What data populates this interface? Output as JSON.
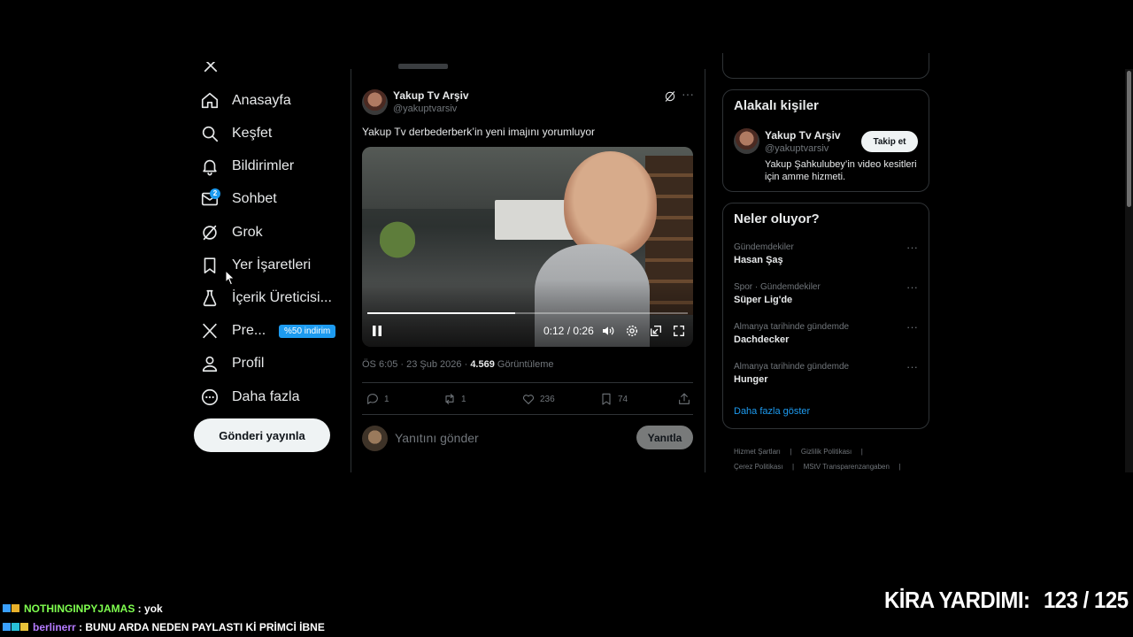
{
  "sidebar": {
    "items": [
      {
        "label": "Anasayfa",
        "icon": "home-icon"
      },
      {
        "label": "Keşfet",
        "icon": "search-icon"
      },
      {
        "label": "Bildirimler",
        "icon": "bell-icon"
      },
      {
        "label": "Sohbet",
        "icon": "mail-icon",
        "badge": "2"
      },
      {
        "label": "Grok",
        "icon": "grok-icon"
      },
      {
        "label": "Yer İşaretleri",
        "icon": "bookmark-icon"
      },
      {
        "label": "İçerik Üreticisi...",
        "icon": "creator-icon"
      },
      {
        "label": "Pre...",
        "icon": "x-logo-icon",
        "promo": "%50 indirim"
      },
      {
        "label": "Profil",
        "icon": "user-icon"
      },
      {
        "label": "Daha fazla",
        "icon": "more-circle-icon"
      }
    ],
    "post_button": "Gönderi yayınla"
  },
  "tweet": {
    "author_name": "Yakup Tv Arşiv",
    "author_handle": "@yakuptvarsiv",
    "text": "Yakup Tv derbederberk’in yeni imajını yorumluyor",
    "video": {
      "current": "0:12",
      "separator": "/",
      "duration": "0:26",
      "progress": 0.46
    },
    "time": "ÖS 6:05 · 23 Şub 2026 · ",
    "views_count": "4.569",
    "views_label": " Görüntüleme",
    "stats": {
      "replies": "1",
      "reposts": "1",
      "likes": "236",
      "bookmarks": "74"
    },
    "reply_placeholder": "Yanıtını gönder",
    "reply_button": "Yanıtla"
  },
  "related": {
    "title": "Alakalı kişiler",
    "name": "Yakup Tv Arşiv",
    "handle": "@yakuptvarsiv",
    "bio": "Yakup Şahkulubey’in video kesitleri için amme hizmeti.",
    "follow_button": "Takip et"
  },
  "trends": {
    "title": "Neler oluyor?",
    "items": [
      {
        "meta": "Gündemdekiler",
        "name": "Hasan Şaş"
      },
      {
        "meta": "Spor · Gündemdekiler",
        "name": "Süper Lig'de"
      },
      {
        "meta": "Almanya tarihinde gündemde",
        "name": "Dachdecker"
      },
      {
        "meta": "Almanya tarihinde gündemde",
        "name": "Hunger"
      }
    ],
    "show_more": "Daha fazla göster"
  },
  "footer": {
    "links": [
      "Hizmet Şartları",
      "Gizlilik Politikası",
      "Çerez Politikası",
      "MStV Transparenzangaben"
    ],
    "separator": "|"
  },
  "chat": [
    {
      "user": "NOTHINGINPYJAMAS",
      "sep": " : ",
      "message": "yok",
      "color": "#7fff4f"
    },
    {
      "user": "berlinerr",
      "sep": " : ",
      "message": "BUNU ARDA NEDEN PAYLASTI Kİ PRİMCİ İBNE",
      "color": "#b57bff"
    }
  ],
  "overlay": {
    "label": "KİRA YARDIMI:",
    "value": "123 / 125"
  },
  "colors": {
    "accent": "#1d9bf0",
    "background": "#000000",
    "border": "#2f3336",
    "muted": "#71767b"
  }
}
